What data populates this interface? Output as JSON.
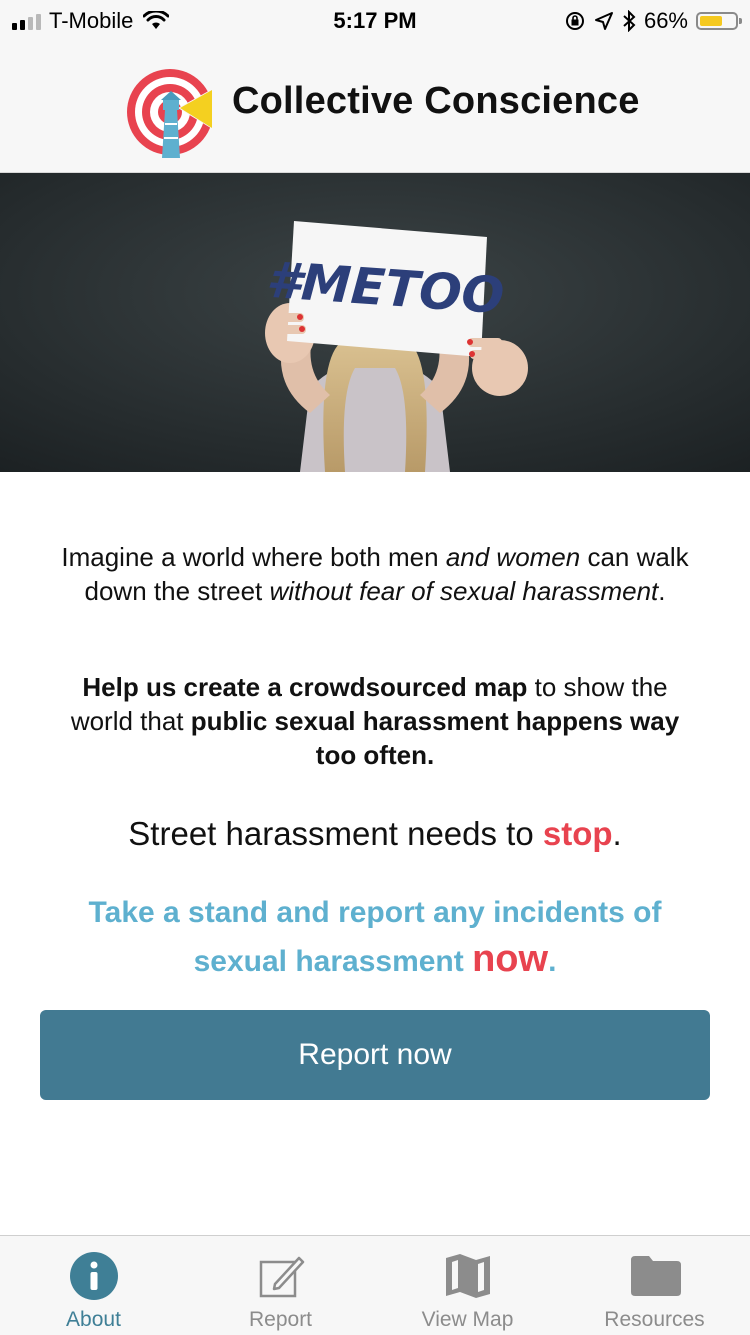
{
  "status_bar": {
    "carrier": "T-Mobile",
    "time": "5:17 PM",
    "battery": "66%",
    "battery_level": 0.66,
    "icons": [
      "signal-icon",
      "wifi-icon",
      "orientation-lock-icon",
      "location-icon",
      "bluetooth-icon",
      "battery-icon"
    ]
  },
  "header": {
    "title": "Collective Conscience",
    "logo_icon": "lighthouse-target-logo"
  },
  "hero": {
    "sign_text": "#METOO"
  },
  "content": {
    "p1": {
      "a": "Imagine a world where both men ",
      "b": "and women",
      "c": " can walk down the street ",
      "d": "without fear of sexual harassment",
      "e": "."
    },
    "p2": {
      "a": "Help us create a crowdsourced map",
      "b": " to show the world that ",
      "c": "public sexual harassment happens way too often."
    },
    "p3": {
      "a": "Street harassment needs to ",
      "b": "stop",
      "c": "."
    },
    "p4": {
      "a": "Take a stand and report any incidents of sexual harassment ",
      "b": "now",
      "c": "."
    },
    "button_label": "Report now"
  },
  "tabs": [
    {
      "label": "About",
      "icon": "info-icon",
      "active": true
    },
    {
      "label": "Report",
      "icon": "edit-icon",
      "active": false
    },
    {
      "label": "View Map",
      "icon": "map-icon",
      "active": false
    },
    {
      "label": "Resources",
      "icon": "folder-icon",
      "active": false
    }
  ],
  "colors": {
    "accent": "#427a92",
    "highlight_red": "#e8434f",
    "highlight_blue": "#5eb0cf",
    "active_tab": "#3f7f96"
  }
}
